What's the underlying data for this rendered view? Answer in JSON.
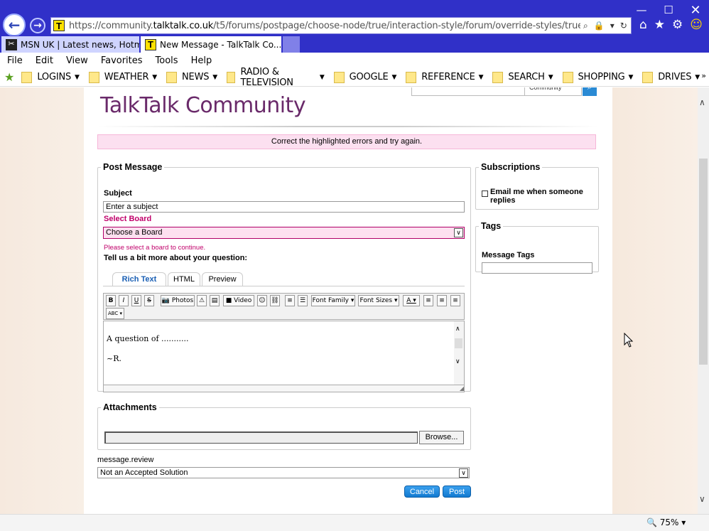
{
  "browser": {
    "url_prefix": "https://community.",
    "url_domain": "talktalk.co.uk",
    "url_rest": "/t5/forums/postpage/choose-node/true/interaction-style/forum/override-styles/true?autoComplete=fals",
    "tabs": [
      {
        "label": "MSN UK | Latest news, Hotmail..."
      },
      {
        "label": "New Message - TalkTalk Co..."
      }
    ],
    "menu": [
      "File",
      "Edit",
      "View",
      "Favorites",
      "Tools",
      "Help"
    ],
    "favorites": [
      "LOGINS",
      "WEATHER",
      "NEWS",
      "RADIO & TELEVISION",
      "GOOGLE",
      "REFERENCE",
      "SEARCH",
      "SHOPPING",
      "DRIVES"
    ],
    "zoom": "75%",
    "colors": {
      "chrome": "#3030c8",
      "accent": "#6a2a6a",
      "error": "#c0006a"
    }
  },
  "page": {
    "brand": "TalkTalk Community",
    "search_scope": "Community",
    "error_banner": "Correct the highlighted errors and try again.",
    "post": {
      "legend": "Post Message",
      "subject_label": "Subject",
      "subject_value": "Enter a subject",
      "board_label": "Select Board",
      "board_value": "Choose a Board",
      "board_error": "Please select a board to continue.",
      "question_label": "Tell us a bit more about your question:",
      "tabs": [
        "Rich Text",
        "HTML",
        "Preview"
      ],
      "toolbar": {
        "photos": "Photos",
        "video": "Video",
        "font_family": "Font Family",
        "font_sizes": "Font Sizes"
      },
      "body_line1": "A question of ...........",
      "body_line2": "~R."
    },
    "subscriptions": {
      "legend": "Subscriptions",
      "email_label": "Email me when someone replies"
    },
    "tags": {
      "legend": "Tags",
      "label": "Message Tags"
    },
    "attachments": {
      "legend": "Attachments",
      "browse": "Browse..."
    },
    "review": {
      "label": "message.review",
      "value": "Not an Accepted Solution"
    },
    "buttons": {
      "cancel": "Cancel",
      "post": "Post"
    }
  }
}
